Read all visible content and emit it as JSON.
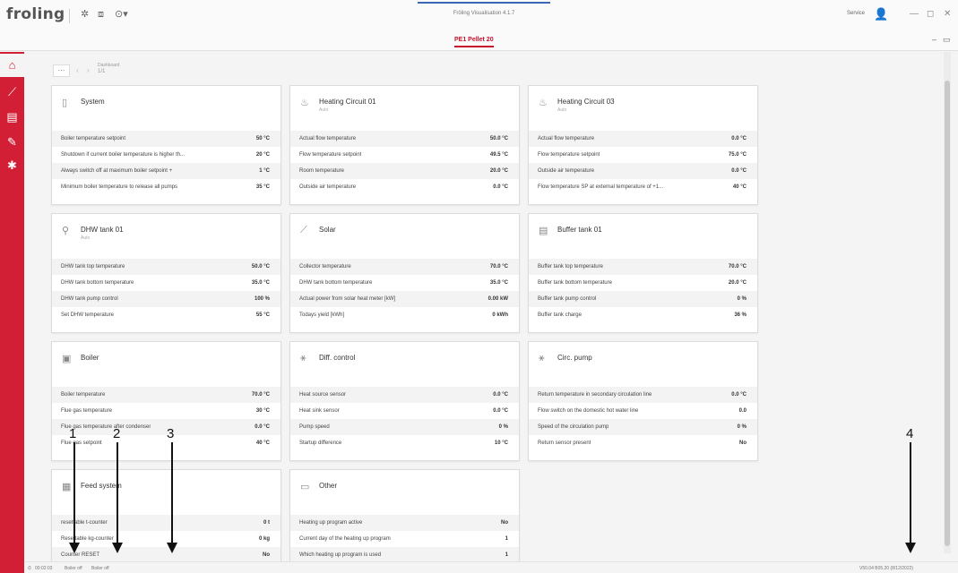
{
  "titlebar": {
    "logo": "froling",
    "app_title": "Fröling Visualisation 4.1.7",
    "service": "Service",
    "min": "—",
    "max": "◻",
    "close": "✕"
  },
  "tabbar": {
    "device_tab": "PE1 Pellet 20"
  },
  "toolbar": {
    "more": "···",
    "breadcrumb": "Dashboard",
    "page": "1/1"
  },
  "cards": {
    "system": {
      "title": "System",
      "rows": [
        {
          "label": "Boiler temperature setpoint",
          "value": "50 °C"
        },
        {
          "label": "Shutdown if current boiler temperature is higher th...",
          "value": "20 °C"
        },
        {
          "label": "Always switch off at maximum boiler setpoint +",
          "value": "1 °C"
        },
        {
          "label": "Minimum boiler temperature to release all pumps",
          "value": "35 °C"
        }
      ]
    },
    "hc01": {
      "title": "Heating Circuit 01",
      "subtitle": "Auto",
      "rows": [
        {
          "label": "Actual flow temperature",
          "value": "50.0 °C"
        },
        {
          "label": "Flow temperature setpoint",
          "value": "49.5 °C"
        },
        {
          "label": "Room temperature",
          "value": "20.0 °C"
        },
        {
          "label": "Outside air temperature",
          "value": "0.0 °C"
        }
      ]
    },
    "hc03": {
      "title": "Heating Circuit 03",
      "subtitle": "Auto",
      "rows": [
        {
          "label": "Actual flow temperature",
          "value": "0.0 °C"
        },
        {
          "label": "Flow temperature setpoint",
          "value": "75.0 °C"
        },
        {
          "label": "Outside air temperature",
          "value": "0.0 °C"
        },
        {
          "label": "Flow temperature SP at external temperature of +1...",
          "value": "40 °C"
        }
      ]
    },
    "dhw": {
      "title": "DHW tank 01",
      "subtitle": "Auto",
      "rows": [
        {
          "label": "DHW tank top temperature",
          "value": "50.0 °C"
        },
        {
          "label": "DHW tank bottom temperature",
          "value": "35.0 °C"
        },
        {
          "label": "DHW tank pump control",
          "value": "100 %"
        },
        {
          "label": "Set DHW temperature",
          "value": "55 °C"
        }
      ]
    },
    "solar": {
      "title": "Solar",
      "rows": [
        {
          "label": "Collector temperature",
          "value": "70.0 °C"
        },
        {
          "label": "DHW tank bottom temperature",
          "value": "35.0 °C"
        },
        {
          "label": "Actual power from solar heat meter [kW]",
          "value": "0.00 kW"
        },
        {
          "label": "Todays yield [kWh]",
          "value": "0 kWh"
        }
      ]
    },
    "buffer": {
      "title": "Buffer tank 01",
      "rows": [
        {
          "label": "Buffer tank top temperature",
          "value": "70.0 °C"
        },
        {
          "label": "Buffer tank bottom temperature",
          "value": "20.0 °C"
        },
        {
          "label": "Buffer tank pump control",
          "value": "0 %"
        },
        {
          "label": "Buffer tank charge",
          "value": "36 %"
        }
      ]
    },
    "boiler": {
      "title": "Boiler",
      "rows": [
        {
          "label": "Boiler temperature",
          "value": "70.0 °C"
        },
        {
          "label": "Flue gas temperature",
          "value": "30 °C"
        },
        {
          "label": "Flue gas temperature after condenser",
          "value": "0.0 °C"
        },
        {
          "label": "Flue gas setpoint",
          "value": "40 °C"
        }
      ]
    },
    "diff": {
      "title": "Diff. control",
      "rows": [
        {
          "label": "Heat source sensor",
          "value": "0.0 °C"
        },
        {
          "label": "Heat sink sensor",
          "value": "0.0 °C"
        },
        {
          "label": "Pump speed",
          "value": "0 %"
        },
        {
          "label": "Startup difference",
          "value": "10 °C"
        }
      ]
    },
    "circ": {
      "title": "Circ. pump",
      "rows": [
        {
          "label": "Return temperature in secondary circulation line",
          "value": "0.0 °C"
        },
        {
          "label": "Flow switch on the domestic hot water line",
          "value": "0.0"
        },
        {
          "label": "Speed of the circulation pump",
          "value": "0 %"
        },
        {
          "label": "Return sensor present",
          "value": "No"
        }
      ]
    },
    "feed": {
      "title": "Feed system",
      "rows": [
        {
          "label": "resettable t-counter",
          "value": "0 t"
        },
        {
          "label": "Resettable kg-counter",
          "value": "0 kg"
        },
        {
          "label": "Counter RESET",
          "value": "No"
        }
      ]
    },
    "other": {
      "title": "Other",
      "rows": [
        {
          "label": "Heating up program active",
          "value": "No"
        },
        {
          "label": "Current day of the heating up program",
          "value": "1"
        },
        {
          "label": "Which heating up program is used",
          "value": "1"
        }
      ]
    }
  },
  "statusbar": {
    "time": "00:02:03",
    "state1": "Boiler off",
    "state2": "Boiler off",
    "version": "V50.04 B05.20 (8/12/2022)"
  },
  "annotations": [
    "1",
    "2",
    "3",
    "4"
  ]
}
